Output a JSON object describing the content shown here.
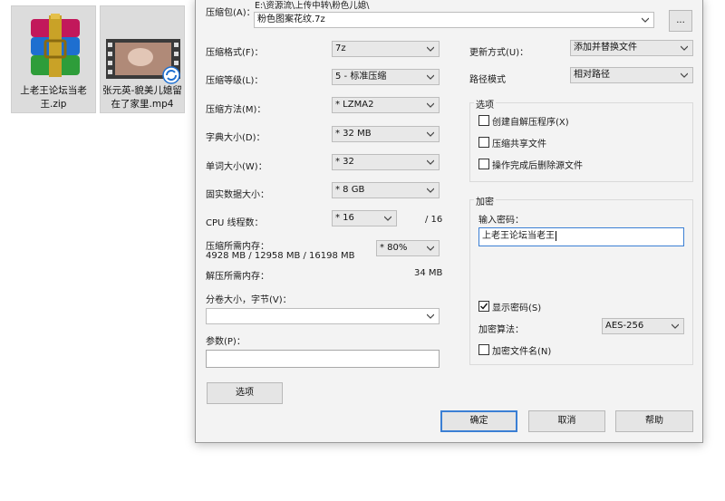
{
  "desktop": {
    "icons": [
      {
        "label": "上老王论坛当老王.zip",
        "icon": "winrar-archive-icon"
      },
      {
        "label": "张元英-貌美儿媳留在了家里.mp4",
        "icon": "video-file-icon",
        "overlay": "sync-badge-icon"
      }
    ]
  },
  "dialog": {
    "archive": {
      "label": "压缩包(A)：",
      "path": "E:\\资源流\\上传中转\\粉色儿媳\\",
      "filename": "粉色图案花纹.7z",
      "browse_label": "..."
    },
    "left": {
      "format": {
        "label": "压缩格式(F)：",
        "value": "7z"
      },
      "level": {
        "label": "压缩等级(L)：",
        "value": "5 - 标准压缩"
      },
      "method": {
        "label": "压缩方法(M)：",
        "value": "* LZMA2"
      },
      "dict": {
        "label": "字典大小(D)：",
        "value": "* 32 MB"
      },
      "word": {
        "label": "单词大小(W)：",
        "value": "* 32"
      },
      "solid": {
        "label": "固实数据大小：",
        "value": "* 8 GB"
      },
      "cpu": {
        "label": "CPU 线程数：",
        "value": "* 16",
        "total": "/ 16"
      },
      "mem_compress": {
        "label": "压缩所需内存：",
        "detail": "4928 MB / 12958 MB / 16198 MB",
        "value": "* 80%"
      },
      "mem_decompress": {
        "label": "解压所需内存：",
        "value": "34 MB"
      },
      "volume": {
        "label": "分卷大小，字节(V)：",
        "value": ""
      },
      "params": {
        "label": "参数(P)：",
        "value": ""
      },
      "options_button": "选项"
    },
    "right": {
      "update_mode": {
        "label": "更新方式(U)：",
        "value": "添加并替换文件"
      },
      "path_mode": {
        "label": "路径模式",
        "value": "相对路径"
      },
      "options_group": {
        "title": "选项",
        "items": [
          {
            "label": "创建自解压程序(X)",
            "checked": false
          },
          {
            "label": "压缩共享文件",
            "checked": false
          },
          {
            "label": "操作完成后删除源文件",
            "checked": false
          }
        ]
      },
      "encryption_group": {
        "title": "加密",
        "password_label": "输入密码：",
        "password_value": "上老王论坛当老王",
        "show_password": {
          "label": "显示密码(S)",
          "checked": true
        },
        "method_label": "加密算法：",
        "method_value": "AES-256",
        "encrypt_names": {
          "label": "加密文件名(N)",
          "checked": false
        }
      }
    },
    "buttons": {
      "ok": "确定",
      "cancel": "取消",
      "help": "帮助"
    }
  }
}
